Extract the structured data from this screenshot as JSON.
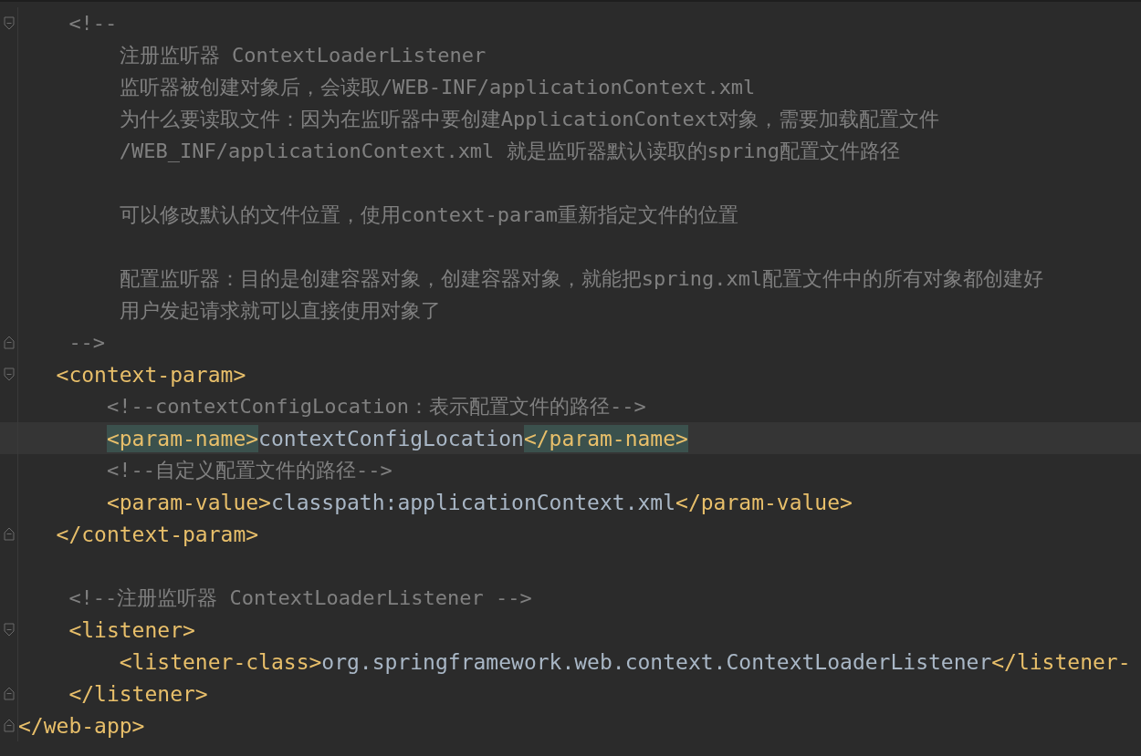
{
  "editor": {
    "lines": [
      {
        "kind": "mid",
        "fold_start": true,
        "segments": [
          {
            "kind": "comment",
            "text": "<!--"
          }
        ]
      },
      {
        "kind": "deeper",
        "segments": [
          {
            "kind": "comment",
            "text": "注册监听器 ContextLoaderListener"
          }
        ]
      },
      {
        "kind": "deeper",
        "segments": [
          {
            "kind": "comment",
            "text": "监听器被创建对象后，会读取/WEB-INF/applicationContext.xml"
          }
        ]
      },
      {
        "kind": "deeper",
        "segments": [
          {
            "kind": "comment",
            "text": "为什么要读取文件：因为在监听器中要创建ApplicationContext对象，需要加载配置文件"
          }
        ]
      },
      {
        "kind": "deeper",
        "segments": [
          {
            "kind": "comment",
            "text": "/WEB_INF/applicationContext.xml 就是监听器默认读取的spring配置文件路径"
          }
        ]
      },
      {
        "kind": "blank"
      },
      {
        "kind": "deeper",
        "segments": [
          {
            "kind": "comment",
            "text": "可以修改默认的文件位置，使用context-param重新指定文件的位置"
          }
        ]
      },
      {
        "kind": "blank"
      },
      {
        "kind": "deeper",
        "segments": [
          {
            "kind": "comment",
            "text": "配置监听器：目的是创建容器对象，创建容器对象，就能把spring.xml配置文件中的所有对象都创建好"
          }
        ]
      },
      {
        "kind": "deeper",
        "segments": [
          {
            "kind": "comment",
            "text": "用户发起请求就可以直接使用对象了"
          }
        ]
      },
      {
        "kind": "mid",
        "fold_end": true,
        "segments": [
          {
            "kind": "comment",
            "text": "-->"
          }
        ]
      },
      {
        "kind": "shallow",
        "fold_start": true,
        "segments": [
          {
            "kind": "tag",
            "text": "<context-param>",
            "matched": false
          }
        ]
      },
      {
        "kind": "deep",
        "segments": [
          {
            "kind": "comment",
            "text": "<!--contextConfigLocation：表示配置文件的路径-->"
          }
        ]
      },
      {
        "kind": "deep",
        "highlighted": true,
        "segments": [
          {
            "kind": "tag",
            "text": "<param-name>",
            "matched": true
          },
          {
            "kind": "text",
            "text": "contextConfigLocation"
          },
          {
            "kind": "tag",
            "text": "</param-name>",
            "matched": true
          }
        ]
      },
      {
        "kind": "deep",
        "segments": [
          {
            "kind": "comment",
            "text": "<!--自定义配置文件的路径-->"
          }
        ]
      },
      {
        "kind": "deep",
        "segments": [
          {
            "kind": "tag",
            "text": "<param-value>",
            "matched": false
          },
          {
            "kind": "text",
            "text": "classpath:applicationContext.xml"
          },
          {
            "kind": "tag",
            "text": "</param-value>",
            "matched": false
          }
        ]
      },
      {
        "kind": "shallow",
        "fold_end": true,
        "segments": [
          {
            "kind": "tag",
            "text": "</context-param>",
            "matched": false
          }
        ]
      },
      {
        "kind": "blank"
      },
      {
        "kind": "mid",
        "segments": [
          {
            "kind": "comment",
            "text": "<!--注册监听器 ContextLoaderListener -->"
          }
        ]
      },
      {
        "kind": "mid",
        "fold_start": true,
        "segments": [
          {
            "kind": "tag",
            "text": "<listener>",
            "matched": false
          }
        ]
      },
      {
        "kind": "deeper",
        "segments": [
          {
            "kind": "tag",
            "text": "<listener-class>",
            "matched": false
          },
          {
            "kind": "text",
            "text": "org.springframework.web.context.ContextLoaderListener"
          },
          {
            "kind": "tag",
            "text": "</listener-",
            "matched": false
          }
        ]
      },
      {
        "kind": "mid",
        "fold_end": true,
        "segments": [
          {
            "kind": "tag",
            "text": "</listener>",
            "matched": false
          }
        ]
      },
      {
        "kind": "root",
        "fold_end": true,
        "segments": [
          {
            "kind": "tag",
            "text": "</web-app>",
            "matched": false
          }
        ]
      }
    ]
  }
}
